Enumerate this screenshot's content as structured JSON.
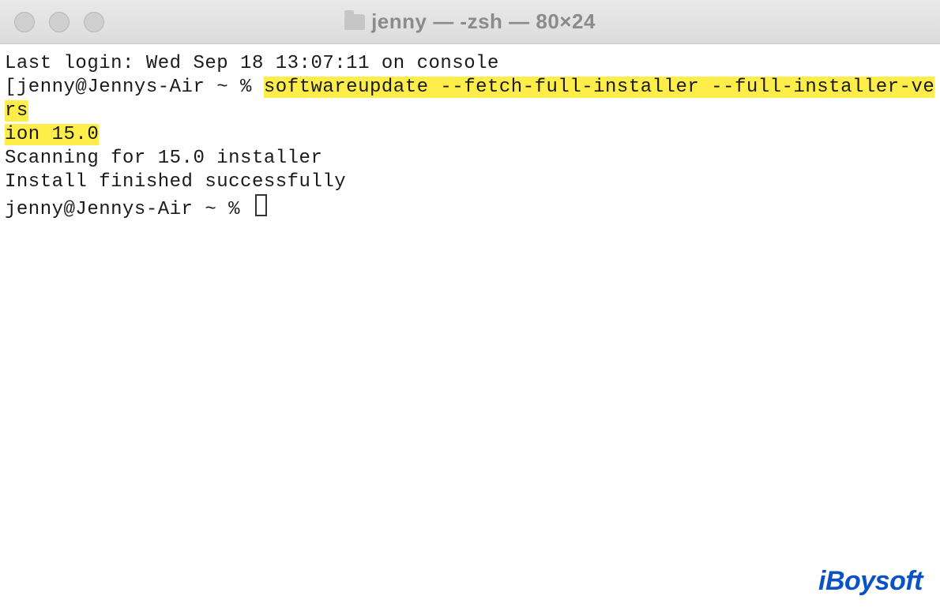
{
  "window": {
    "title": "jenny — -zsh — 80×24"
  },
  "terminal": {
    "last_login": "Last login: Wed Sep 18 13:07:11 on console",
    "prompt1_bracket": "[",
    "prompt1_pre": "jenny@Jennys-Air ~ % ",
    "highlight_part1": "softwareupdate --fetch-full-installer --full-installer-vers",
    "highlight_part2": "ion 15.0",
    "out_line1": "Scanning for 15.0 installer",
    "out_line2": "Install finished successfully",
    "prompt2": "jenny@Jennys-Air ~ % "
  },
  "watermark": "iBoysoft"
}
